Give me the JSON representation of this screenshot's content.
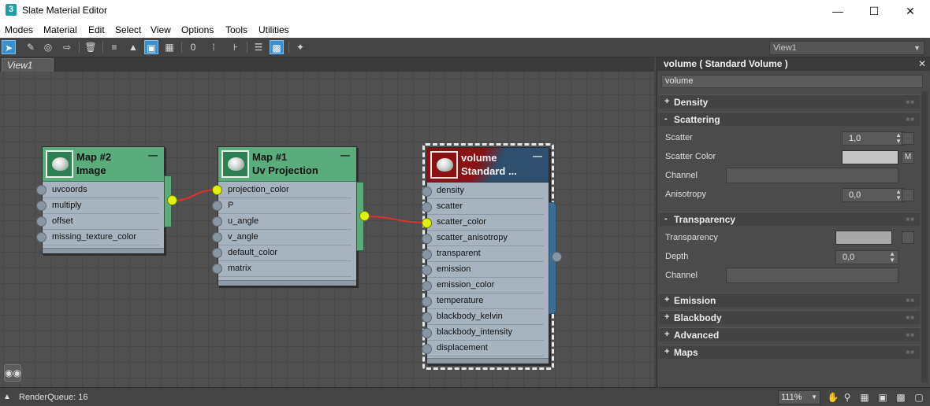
{
  "window": {
    "title": "Slate Material Editor",
    "app_icon_glyph": "3",
    "controls": [
      "minimize-icon",
      "maximize-icon",
      "close-icon"
    ]
  },
  "menu": [
    "Modes",
    "Material",
    "Edit",
    "Select",
    "View",
    "Options",
    "Tools",
    "Utilities"
  ],
  "toolbar": {
    "icons": [
      "select-arrow-icon",
      "eyedropper-icon",
      "material-pick-icon",
      "assign-material-icon",
      "delete-icon",
      "move-children-icon",
      "hide-unused-slots-icon",
      "show-map-in-viewport-icon",
      "checker-background-icon",
      "material-id-icon",
      "background-icon",
      "layout-children-icon",
      "layout-all-icon",
      "show-end-result-icon",
      "material-selector-icon"
    ],
    "view_select": "View1"
  },
  "view_tab": "View1",
  "nodes": [
    {
      "id": "map2",
      "title_line1": "Map #2",
      "title_line2": "Image",
      "slots": [
        "uvcoords",
        "multiply",
        "offset",
        "missing_texture_color"
      ],
      "connected_slots": []
    },
    {
      "id": "map1",
      "title_line1": "Map #1",
      "title_line2": "Uv Projection",
      "slots": [
        "projection_color",
        "P",
        "u_angle",
        "v_angle",
        "default_color",
        "matrix"
      ],
      "connected_slots": [
        "projection_color"
      ]
    },
    {
      "id": "volume",
      "title_line1": "volume",
      "title_line2": "Standard ...",
      "slots": [
        "density",
        "scatter",
        "scatter_color",
        "scatter_anisotropy",
        "transparent",
        "emission",
        "emission_color",
        "temperature",
        "blackbody_kelvin",
        "blackbody_intensity",
        "displacement"
      ],
      "connected_slots": [
        "scatter_color"
      ]
    }
  ],
  "node_colors": {
    "map_header": "#5aac7c",
    "material_header_dark": "#2f4f6e",
    "material_header_red": "#8a1212",
    "body": "#a7b4c0",
    "wire": "#e0302a",
    "socket_connected": "#e0f20c"
  },
  "panel": {
    "title": "volume  ( Standard Volume )",
    "name_field": "volume",
    "rollouts": {
      "density": {
        "label": "Density",
        "sign": "+"
      },
      "scattering": {
        "label": "Scattering",
        "sign": "-",
        "scatter_label": "Scatter",
        "scatter_value": "1,0",
        "scatter_color_label": "Scatter Color",
        "scatter_color": "#c4c4c4",
        "map_button": "M",
        "channel_label": "Channel",
        "anisotropy_label": "Anisotropy",
        "anisotropy_value": "0,0"
      },
      "transparency": {
        "label": "Transparency",
        "sign": "-",
        "transparency_label": "Transparency",
        "transparency_color": "#a8a8a8",
        "depth_label": "Depth",
        "depth_value": "0,0",
        "channel_label": "Channel"
      },
      "emission": {
        "label": "Emission",
        "sign": "+"
      },
      "blackbody": {
        "label": "Blackbody",
        "sign": "+"
      },
      "advanced": {
        "label": "Advanced",
        "sign": "+"
      },
      "maps": {
        "label": "Maps",
        "sign": "+"
      }
    }
  },
  "status": {
    "text": "RenderQueue: 16",
    "zoom": "111%",
    "icons": [
      "pan-hand-icon",
      "zoom-icon",
      "zoom-region-icon",
      "zoom-extents-icon",
      "zoom-extents-selected-icon",
      "frame-icon"
    ]
  }
}
